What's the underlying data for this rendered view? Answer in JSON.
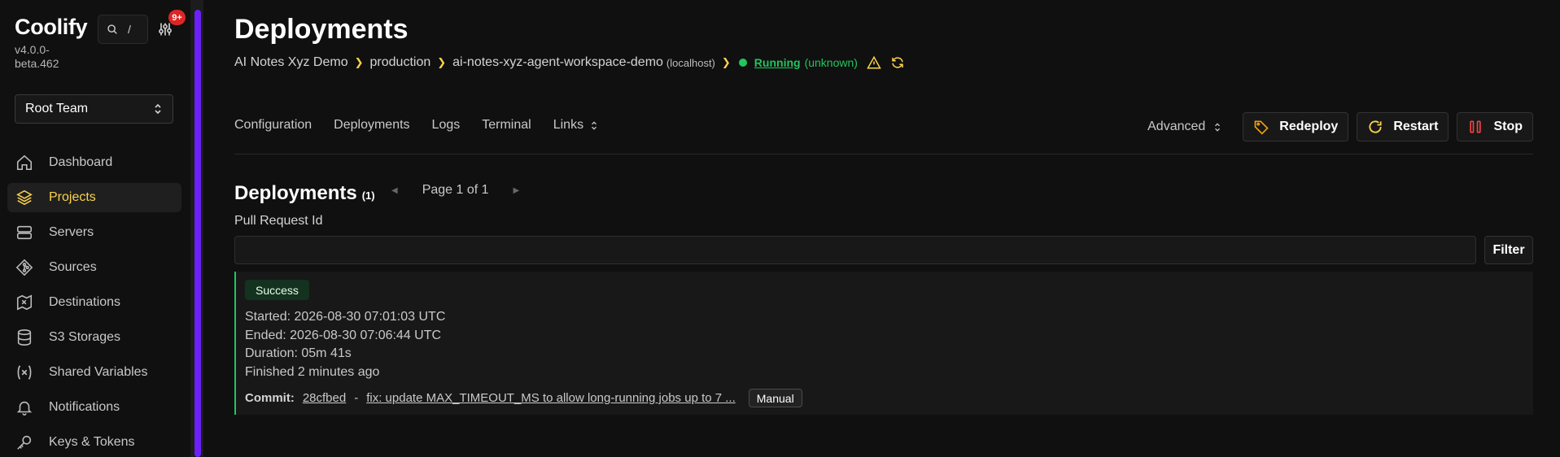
{
  "sidebar": {
    "logo": "Coolify",
    "version": "v4.0.0-beta.462",
    "search_shortcut": "/",
    "notification_badge": "9+",
    "team": "Root Team",
    "items": [
      {
        "label": "Dashboard",
        "icon": "home-icon",
        "active": false
      },
      {
        "label": "Projects",
        "icon": "layers-icon",
        "active": true
      },
      {
        "label": "Servers",
        "icon": "server-icon",
        "active": false
      },
      {
        "label": "Sources",
        "icon": "git-icon",
        "active": false
      },
      {
        "label": "Destinations",
        "icon": "map-icon",
        "active": false
      },
      {
        "label": "S3 Storages",
        "icon": "database-icon",
        "active": false
      },
      {
        "label": "Shared Variables",
        "icon": "variable-icon",
        "active": false
      },
      {
        "label": "Notifications",
        "icon": "bell-icon",
        "active": false
      },
      {
        "label": "Keys & Tokens",
        "icon": "key-icon",
        "active": false
      }
    ]
  },
  "header": {
    "title": "Deployments",
    "breadcrumb": {
      "project": "AI Notes Xyz Demo",
      "environment": "production",
      "resource": "ai-notes-xyz-agent-workspace-demo",
      "server": "(localhost)",
      "status": "Running",
      "status_detail": "(unknown)"
    }
  },
  "tabs": [
    "Configuration",
    "Deployments",
    "Logs",
    "Terminal",
    "Links"
  ],
  "actions": {
    "advanced": "Advanced",
    "redeploy": "Redeploy",
    "restart": "Restart",
    "stop": "Stop"
  },
  "deployments": {
    "title": "Deployments",
    "count": "(1)",
    "page_text": "Page 1 of 1",
    "filter_label": "Pull Request Id",
    "filter_value": "",
    "filter_button": "Filter",
    "items": [
      {
        "status": "Success",
        "started": "Started: 2026-08-30 07:01:03 UTC",
        "ended": "Ended: 2026-08-30 07:06:44 UTC",
        "duration": "Duration: 05m 41s",
        "finished": "Finished 2 minutes ago",
        "commit_label": "Commit:",
        "commit_hash": "28cfbed",
        "commit_separator": "-",
        "commit_message": "fix: update MAX_TIMEOUT_MS to allow long-running jobs up to 7 ...",
        "trigger": "Manual"
      }
    ]
  },
  "colors": {
    "accent": "#fcd34d",
    "running": "#22c55e",
    "scrollbar": "#6b21f8",
    "badge": "#dc2626"
  }
}
